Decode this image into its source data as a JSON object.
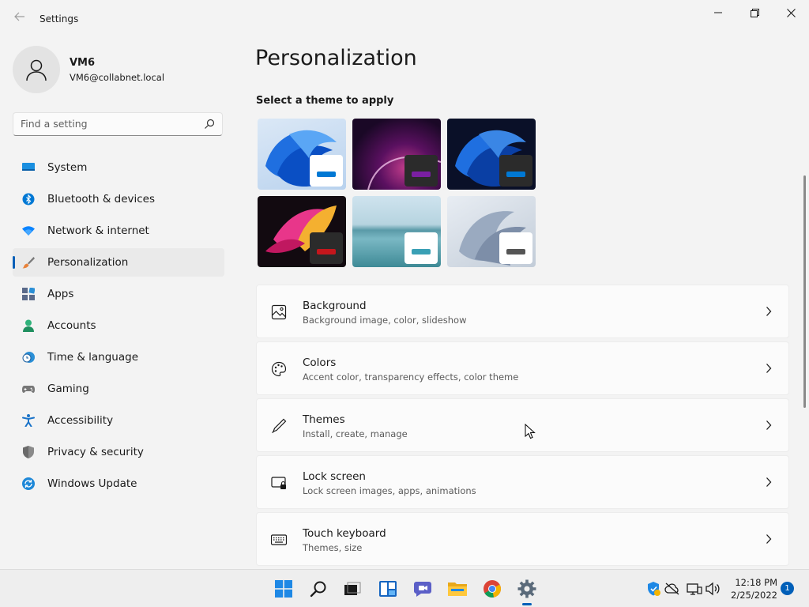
{
  "window": {
    "title": "Settings",
    "controls": [
      "minimize",
      "maximize",
      "close"
    ]
  },
  "profile": {
    "name": "VM6",
    "email": "VM6@collabnet.local"
  },
  "search": {
    "placeholder": "Find a setting"
  },
  "sidebar": {
    "items": [
      {
        "label": "System",
        "icon": "monitor-icon",
        "color": "#0078d4"
      },
      {
        "label": "Bluetooth & devices",
        "icon": "bluetooth-icon",
        "color": "#0078d4"
      },
      {
        "label": "Network & internet",
        "icon": "wifi-icon",
        "color": "#0a84ff"
      },
      {
        "label": "Personalization",
        "icon": "paintbrush-icon",
        "color": "#e8823a",
        "selected": true
      },
      {
        "label": "Apps",
        "icon": "apps-icon",
        "color": "#4a5a7a"
      },
      {
        "label": "Accounts",
        "icon": "person-icon",
        "color": "#2fb27a"
      },
      {
        "label": "Time & language",
        "icon": "clock-globe-icon",
        "color": "#2b8fd6"
      },
      {
        "label": "Gaming",
        "icon": "gamepad-icon",
        "color": "#707070"
      },
      {
        "label": "Accessibility",
        "icon": "accessibility-icon",
        "color": "#1a73c8"
      },
      {
        "label": "Privacy & security",
        "icon": "shield-icon",
        "color": "#6a6a6a"
      },
      {
        "label": "Windows Update",
        "icon": "update-icon",
        "color": "#1e88d8"
      }
    ]
  },
  "main": {
    "title": "Personalization",
    "themes_label": "Select a theme to apply",
    "themes": [
      {
        "name": "windows-light",
        "accent": "#0078d4"
      },
      {
        "name": "glow",
        "accent": "#7a1fa2"
      },
      {
        "name": "windows-dark",
        "accent": "#0078d4"
      },
      {
        "name": "captured-motion",
        "accent": "#c4161c"
      },
      {
        "name": "sunrise-lake",
        "accent": "#3aa0b5"
      },
      {
        "name": "flow",
        "accent": "#555555"
      }
    ],
    "cards": [
      {
        "title": "Background",
        "subtitle": "Background image, color, slideshow",
        "icon": "image-icon"
      },
      {
        "title": "Colors",
        "subtitle": "Accent color, transparency effects, color theme",
        "icon": "palette-icon"
      },
      {
        "title": "Themes",
        "subtitle": "Install, create, manage",
        "icon": "pen-icon"
      },
      {
        "title": "Lock screen",
        "subtitle": "Lock screen images, apps, animations",
        "icon": "lock-screen-icon"
      },
      {
        "title": "Touch keyboard",
        "subtitle": "Themes, size",
        "icon": "keyboard-icon"
      }
    ]
  },
  "taskbar": {
    "apps": [
      "windows-start-icon",
      "search-icon",
      "task-view-icon",
      "widgets-icon",
      "chat-icon",
      "file-explorer-icon",
      "chrome-icon",
      "settings-gear-icon"
    ],
    "active_app": "settings-gear-icon",
    "clock_time": "12:18 PM",
    "clock_date": "2/25/2022",
    "notification_count": "1"
  },
  "colors": {
    "accent": "#005fb8",
    "background": "#f3f3f3",
    "card": "#fbfbfb"
  }
}
